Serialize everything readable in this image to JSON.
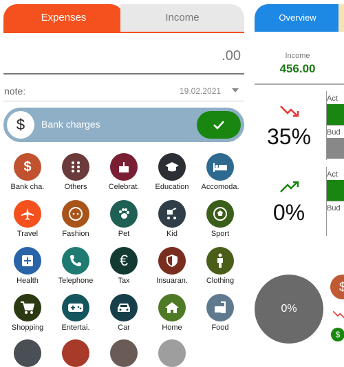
{
  "tabs": {
    "expenses": "Expenses",
    "income": "Income"
  },
  "amount": ".00",
  "note": {
    "label": "note:",
    "date": "19.02.2021"
  },
  "selected": {
    "icon": "$",
    "label": "Bank charges"
  },
  "categories": [
    {
      "label": "Bank cha.",
      "icon": "dollar-icon",
      "color": "#c0522f"
    },
    {
      "label": "Others",
      "icon": "grid-icon",
      "color": "#6b3a3a"
    },
    {
      "label": "Celebrat.",
      "icon": "cake-icon",
      "color": "#7a1f33"
    },
    {
      "label": "Education",
      "icon": "graduation-cap-icon",
      "color": "#2b2f33"
    },
    {
      "label": "Accomoda.",
      "icon": "bed-icon",
      "color": "#2e6a8f"
    },
    {
      "label": "Travel",
      "icon": "airplane-icon",
      "color": "#f4511e"
    },
    {
      "label": "Fashion",
      "icon": "face-icon",
      "color": "#a8541b"
    },
    {
      "label": "Pet",
      "icon": "paw-icon",
      "color": "#1f6055"
    },
    {
      "label": "Kid",
      "icon": "stroller-icon",
      "color": "#2f3e48"
    },
    {
      "label": "Sport",
      "icon": "soccer-ball-icon",
      "color": "#3b5e1a"
    },
    {
      "label": "Health",
      "icon": "medical-plus-icon",
      "color": "#2a64a8"
    },
    {
      "label": "Telephone",
      "icon": "phone-icon",
      "color": "#1f7a72"
    },
    {
      "label": "Tax",
      "icon": "euro-icon",
      "color": "#123a33"
    },
    {
      "label": "Insuaran.",
      "icon": "shield-icon",
      "color": "#7a2e1f"
    },
    {
      "label": "Clothing",
      "icon": "person-icon",
      "color": "#4a5e1a"
    },
    {
      "label": "Shopping",
      "icon": "cart-icon",
      "color": "#2b3a12"
    },
    {
      "label": "Entertai.",
      "icon": "gamepad-icon",
      "color": "#15565e"
    },
    {
      "label": "Car",
      "icon": "car-icon",
      "color": "#173f4a"
    },
    {
      "label": "Home",
      "icon": "home-icon",
      "color": "#4f7a25"
    },
    {
      "label": "Food",
      "icon": "food-icon",
      "color": "#5f7a8f"
    }
  ],
  "overview": {
    "tab": "Overview",
    "income_label": "Income",
    "income_value": "456.00",
    "rows": [
      {
        "percent": "35%",
        "trend": "down",
        "stub_top": "Act",
        "stub_bottom": "Bud"
      },
      {
        "percent": "0%",
        "trend": "up",
        "stub_top": "Act",
        "stub_bottom": "Bud"
      }
    ],
    "pie_label": "0%",
    "bottom_icon": "$"
  },
  "colors": {
    "accent": "#f4511e",
    "overview": "#1e88e5",
    "green": "#19860f",
    "selected_bar": "#8fafc6"
  }
}
